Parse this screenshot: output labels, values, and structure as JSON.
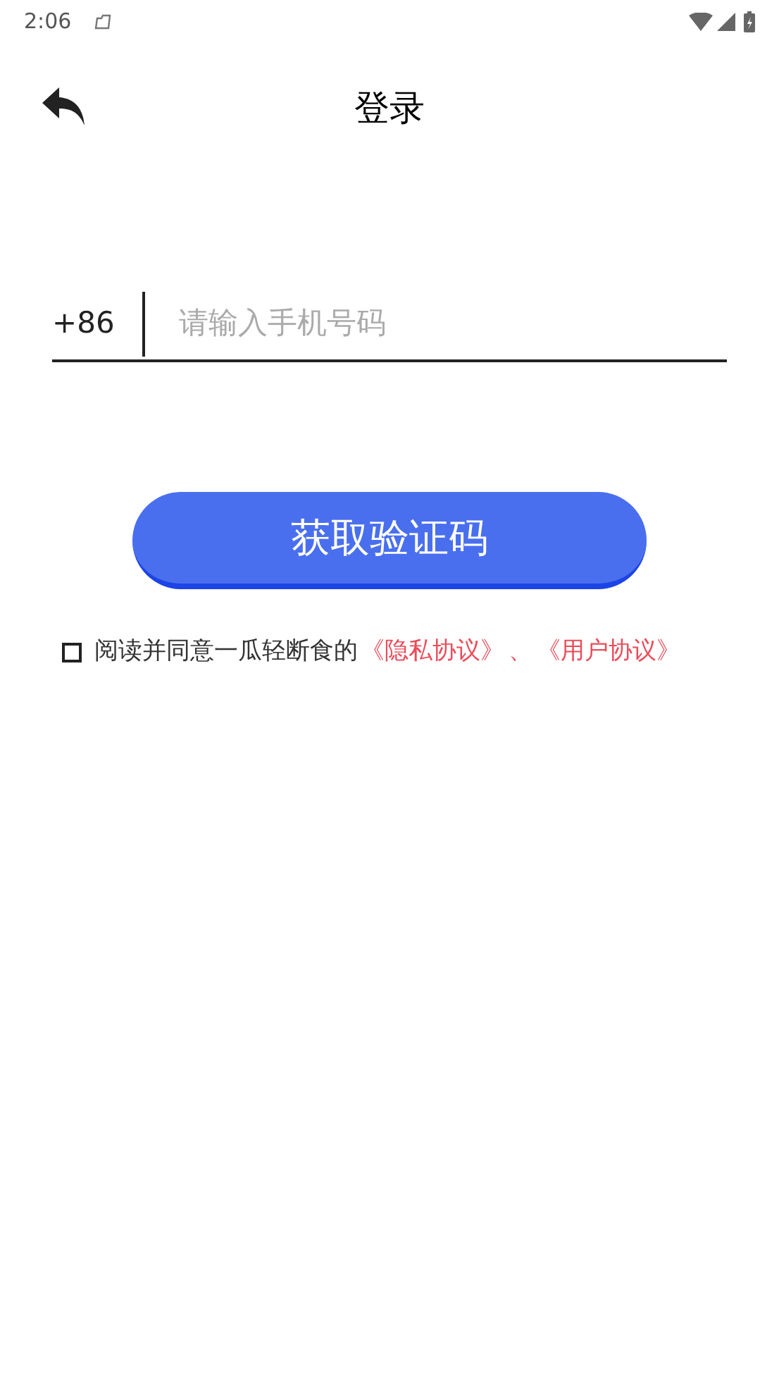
{
  "status_bar": {
    "time": "2:06"
  },
  "header": {
    "title": "登录"
  },
  "phone": {
    "country_code": "+86",
    "placeholder": "请输入手机号码"
  },
  "submit_button": {
    "label": "获取验证码"
  },
  "agreement": {
    "checked": false,
    "text": "阅读并同意一瓜轻断食的",
    "privacy_link": "《隐私协议》",
    "separator": "、",
    "user_link": "《用户协议》"
  }
}
